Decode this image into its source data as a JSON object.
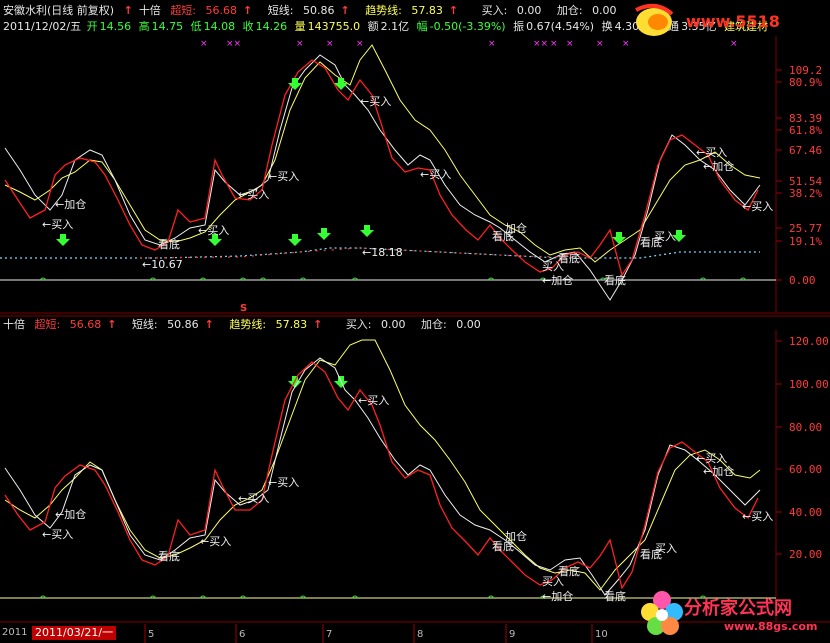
{
  "header": {
    "title": "安徽水利(日线 前复权)",
    "indicator_name": "十倍",
    "chaoduan_label": "超短:",
    "chaoduan_value": "56.68",
    "duanxian_label": "短线:",
    "duanxian_value": "50.86",
    "qushi_label": "趋势线:",
    "qushi_value": "57.83",
    "buy_label": "买入:",
    "buy_value": "0.00",
    "add_label": "加仓:",
    "add_value": "0.00"
  },
  "quote": {
    "date": "2011/12/02/五",
    "open_label": "开",
    "open": "14.56",
    "high_label": "高",
    "high": "14.75",
    "low_label": "低",
    "low": "14.08",
    "close_label": "收",
    "close": "14.26",
    "vol_label": "量",
    "vol": "143755.0",
    "amt_label": "额",
    "amt": "2.1亿",
    "chg_label": "幅",
    "chg": "-0.50(-3.39%)",
    "amp_label": "振",
    "amp": "0.67(4.54%)",
    "turn_label": "换",
    "turn": "4.30%",
    "float_label": "流通",
    "float": "3.35亿",
    "sector": "建筑建材"
  },
  "bottom_header": {
    "indicator_name": "十倍",
    "chaoduan_label": "超短:",
    "chaoduan_value": "56.68",
    "duanxian_label": "短线:",
    "duanxian_value": "50.86",
    "qushi_label": "趋势线:",
    "qushi_value": "57.83",
    "buy_label": "买入:",
    "buy_value": "0.00",
    "add_label": "加仓:",
    "add_value": "0.00"
  },
  "top_axis": [
    "109.2",
    "80.9%",
    "83.39",
    "61.8%",
    "67.46",
    "51.54",
    "38.2%",
    "25.77",
    "19.1%",
    "0.00"
  ],
  "bottom_axis": [
    "120.00",
    "100.00",
    "80.00",
    "60.00",
    "40.00",
    "20.00"
  ],
  "annotations": {
    "buy": "买入",
    "add": "加仓",
    "look_bottom": "看底",
    "price_low": "←10.67",
    "price_high": "←18.18",
    "buy_arrow": "←买入",
    "add_arrow": "←加仓"
  },
  "timeline": {
    "year": "2011",
    "selected_date": "2011/03/21/一",
    "months": [
      "5",
      "6",
      "7",
      "8",
      "9",
      "10"
    ]
  },
  "logos": {
    "top": "www.5518",
    "bottom_title": "分析家公式网",
    "bottom_url": "www.88gs.com"
  },
  "colors": {
    "red_line": "#ff2020",
    "white_line": "#f0f0f0",
    "yellow_line": "#ffff66",
    "grid": "#800000",
    "green_arrow": "#33ff33",
    "magenta": "#ff33ff"
  },
  "sell_mark": "S"
}
